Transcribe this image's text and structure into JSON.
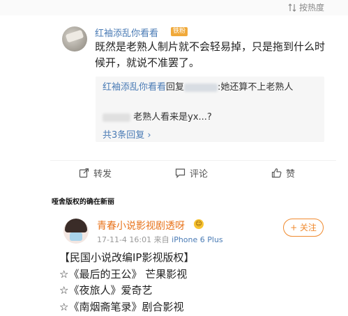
{
  "sort": {
    "label": "按热度"
  },
  "comment": {
    "username": "红袖添乱你看看",
    "badge": "铁粉",
    "text": "既然是老熟人制片就不会轻易掉，只是拖到什么时候开，就说不准罢了。",
    "replies": [
      {
        "user": "红袖添乱你看看",
        "reply_word": "回复",
        "tail": ":她还算不上老熟人"
      },
      {
        "tail": "老熟人看来是yx...?"
      }
    ],
    "more_replies": "共3条回复 ›"
  },
  "actions": {
    "repost": "转发",
    "comment": "评论",
    "like": "赞"
  },
  "caption": "哑舍版权的确在新丽",
  "post": {
    "username": "青春小说影视剧透呀",
    "timestamp": "17-11-4 16:01",
    "source_prefix": "来自",
    "source": "iPhone 6 Plus",
    "follow": "+ 关注",
    "lines": [
      "【民国小说改编IP影视版权】",
      "☆《最后的王公》 芒果影视",
      "☆《夜旅人》爱奇艺",
      "☆《南烟斋笔录》剧合影视"
    ]
  }
}
